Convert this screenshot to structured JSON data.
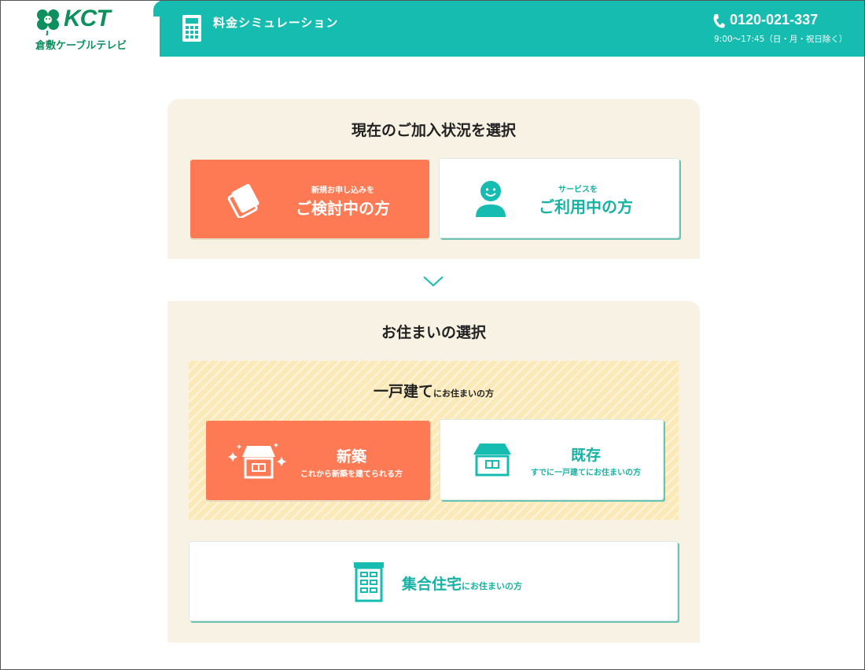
{
  "brand": {
    "logo_text": "KCT",
    "logo_subtitle": "倉敷ケーブルテレビ",
    "color_primary": "#16bcb0",
    "color_accent": "#fd7a55",
    "color_logo": "#0d8f5f"
  },
  "header": {
    "title": "料金シミュレーション",
    "title_icon": "calculator-icon",
    "phone_icon": "phone-icon",
    "phone_number": "0120-021-337",
    "phone_hours": "9:00〜17:45（日・月・祝日除く）"
  },
  "status_section": {
    "title": "現在のご加入状況を選択",
    "options": [
      {
        "small": "新規お申し込みを",
        "big": "ご検討中の方",
        "icon": "card-icon",
        "selected": true
      },
      {
        "small": "サービスを",
        "big": "ご利用中の方",
        "icon": "person-icon",
        "selected": false
      }
    ]
  },
  "residence_section": {
    "title": "お住まいの選択",
    "detached": {
      "title": "一戸建て",
      "title_suffix": "にお住まいの方",
      "options": [
        {
          "big": "新築",
          "small": "これから新築を建てられる方",
          "icon": "new-house-icon",
          "selected": true
        },
        {
          "big": "既存",
          "small": "すでに一戸建てにお住まいの方",
          "icon": "house-icon",
          "selected": false
        }
      ]
    },
    "apartment": {
      "title": "集合住宅",
      "title_suffix": "にお住まいの方",
      "icon": "apartment-icon"
    }
  }
}
